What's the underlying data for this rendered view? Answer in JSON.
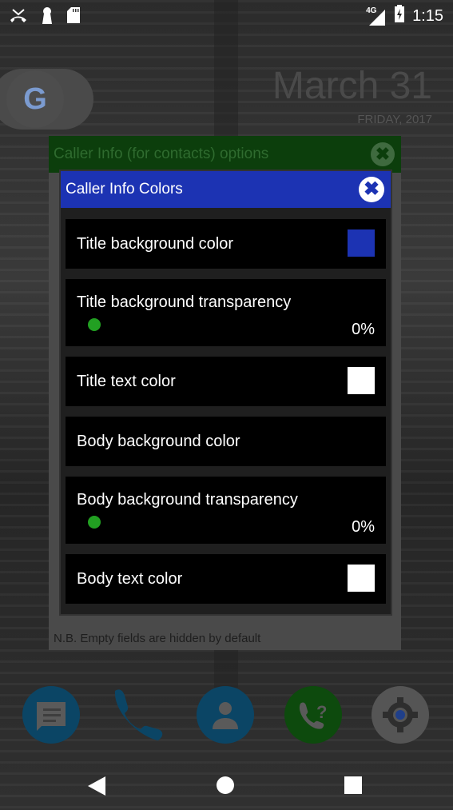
{
  "status_bar": {
    "left_icons": [
      "missed-call-icon",
      "keyhole-icon",
      "sd-card-icon"
    ],
    "network": "4G",
    "time": "1:15"
  },
  "home": {
    "date_main": "March 31",
    "date_sub": "FRIDAY, 2017",
    "google_letter": "G"
  },
  "outer_dialog": {
    "title": "Caller Info (for contacts) options",
    "footer": "N.B. Empty fields are hidden by default",
    "title_bg": "#0c3e0c"
  },
  "inner_dialog": {
    "title": "Caller Info Colors",
    "title_bg": "#1c33b3",
    "rows": [
      {
        "label": "Title background color",
        "type": "color",
        "value": "#1c33b3"
      },
      {
        "label": "Title background transparency",
        "type": "slider",
        "value": "0%",
        "fraction": 0
      },
      {
        "label": "Title text color",
        "type": "color",
        "value": "#ffffff"
      },
      {
        "label": "Body background color",
        "type": "color",
        "value": "#000000"
      },
      {
        "label": "Body background transparency",
        "type": "slider",
        "value": "0%",
        "fraction": 0
      },
      {
        "label": "Body text color",
        "type": "color",
        "value": "#ffffff"
      }
    ]
  },
  "dock": [
    "messages-icon",
    "phone-icon",
    "contacts-icon",
    "caller-info-icon",
    "settings-icon"
  ],
  "nav": [
    "back-button",
    "home-button",
    "recents-button"
  ]
}
